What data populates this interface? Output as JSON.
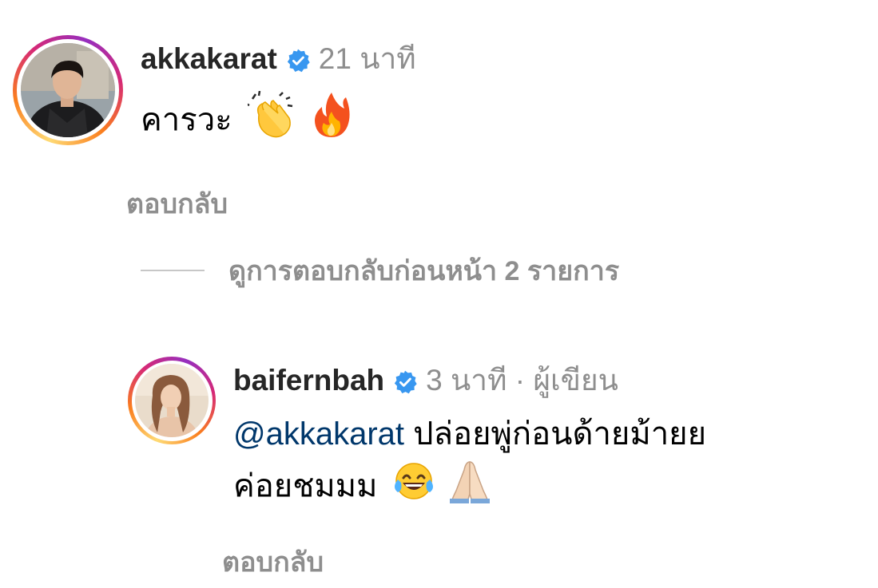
{
  "comments": [
    {
      "username": "akkakarat",
      "verified": true,
      "time": "21 นาที",
      "text": "คารวะ",
      "emojis": [
        "clapping-hands",
        "fire"
      ],
      "reply_label": "ตอบกลับ"
    },
    {
      "username": "baifernbah",
      "verified": true,
      "time": "3 นาที · ผู้เขียน",
      "mention": "@akkakarat",
      "text_line1": "ปล่อยพู่ก่อนด้ายม้ายย",
      "text_line2": "ค่อยชมมม",
      "emojis": [
        "face-with-tears-of-joy",
        "folded-hands"
      ],
      "reply_label": "ตอบกลับ"
    }
  ],
  "view_previous_replies": "ดูการตอบกลับก่อนหน้า 2 รายการ",
  "colors": {
    "verified_blue": "#3897f0",
    "mention": "#00376b",
    "muted": "#8e8e8e",
    "text": "#262626"
  }
}
